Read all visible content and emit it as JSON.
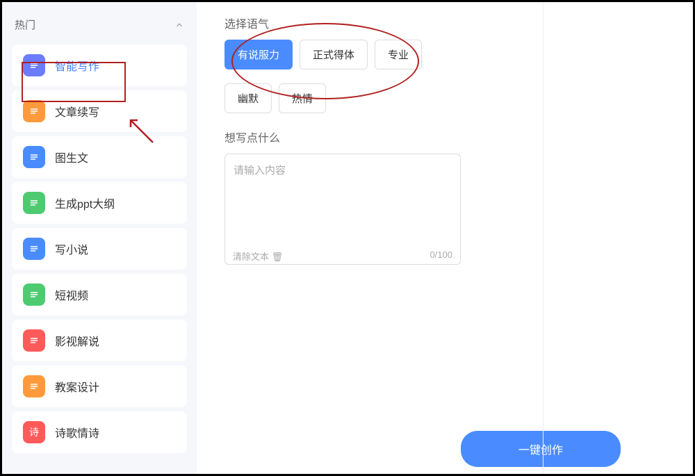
{
  "sidebar": {
    "section_label": "热门",
    "items": [
      {
        "label": "智能写作",
        "icon_color": "#6b7cff",
        "active": true
      },
      {
        "label": "文章续写",
        "icon_color": "#ff9a3c",
        "active": false
      },
      {
        "label": "图生文",
        "icon_color": "#4a8cff",
        "active": false
      },
      {
        "label": "生成ppt大纲",
        "icon_color": "#4ecb71",
        "active": false
      },
      {
        "label": "写小说",
        "icon_color": "#4a8cff",
        "active": false
      },
      {
        "label": "短视频",
        "icon_color": "#4ecb71",
        "active": false
      },
      {
        "label": "影视解说",
        "icon_color": "#ff5a5a",
        "active": false
      },
      {
        "label": "教案设计",
        "icon_color": "#ff9a3c",
        "active": false
      },
      {
        "label": "诗歌情诗",
        "icon_color": "#ff5a5a",
        "active": false,
        "icon_text": "诗"
      }
    ]
  },
  "main": {
    "tone_label": "选择语气",
    "tones": [
      {
        "label": "有说服力",
        "active": true
      },
      {
        "label": "正式得体",
        "active": false
      },
      {
        "label": "专业",
        "active": false
      },
      {
        "label": "幽默",
        "active": false
      },
      {
        "label": "热情",
        "active": false
      }
    ],
    "prompt_label": "想写点什么",
    "textarea_placeholder": "请输入内容",
    "clear_label": "清除文本",
    "counter": "0/100",
    "submit_label": "一键创作"
  }
}
